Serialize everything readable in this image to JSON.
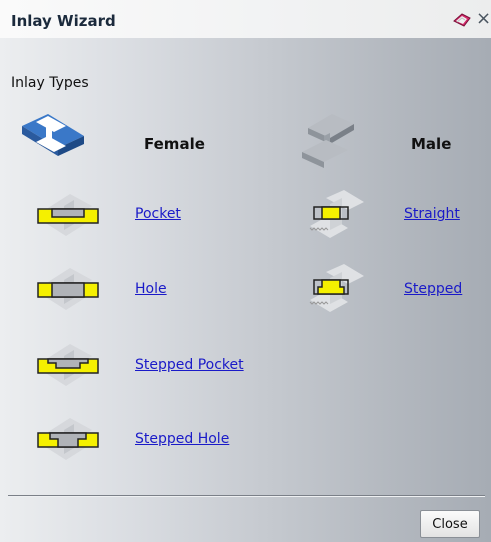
{
  "window": {
    "title": "Inlay Wizard",
    "close_glyph": "×"
  },
  "section": {
    "label": "Inlay Types"
  },
  "female": {
    "heading": "Female",
    "items": [
      {
        "label": "Pocket",
        "icon": "pocket-icon"
      },
      {
        "label": "Hole",
        "icon": "hole-icon"
      },
      {
        "label": "Stepped Pocket",
        "icon": "stepped-pocket-icon"
      },
      {
        "label": "Stepped Hole",
        "icon": "stepped-hole-icon"
      }
    ]
  },
  "male": {
    "heading": "Male",
    "items": [
      {
        "label": "Straight",
        "icon": "straight-icon"
      },
      {
        "label": "Stepped",
        "icon": "stepped-icon"
      }
    ]
  },
  "footer": {
    "close_label": "Close"
  },
  "colors": {
    "insert_yellow": "#f5f000",
    "link": "#1a1ac8",
    "female_badge": "#3a78c8"
  }
}
